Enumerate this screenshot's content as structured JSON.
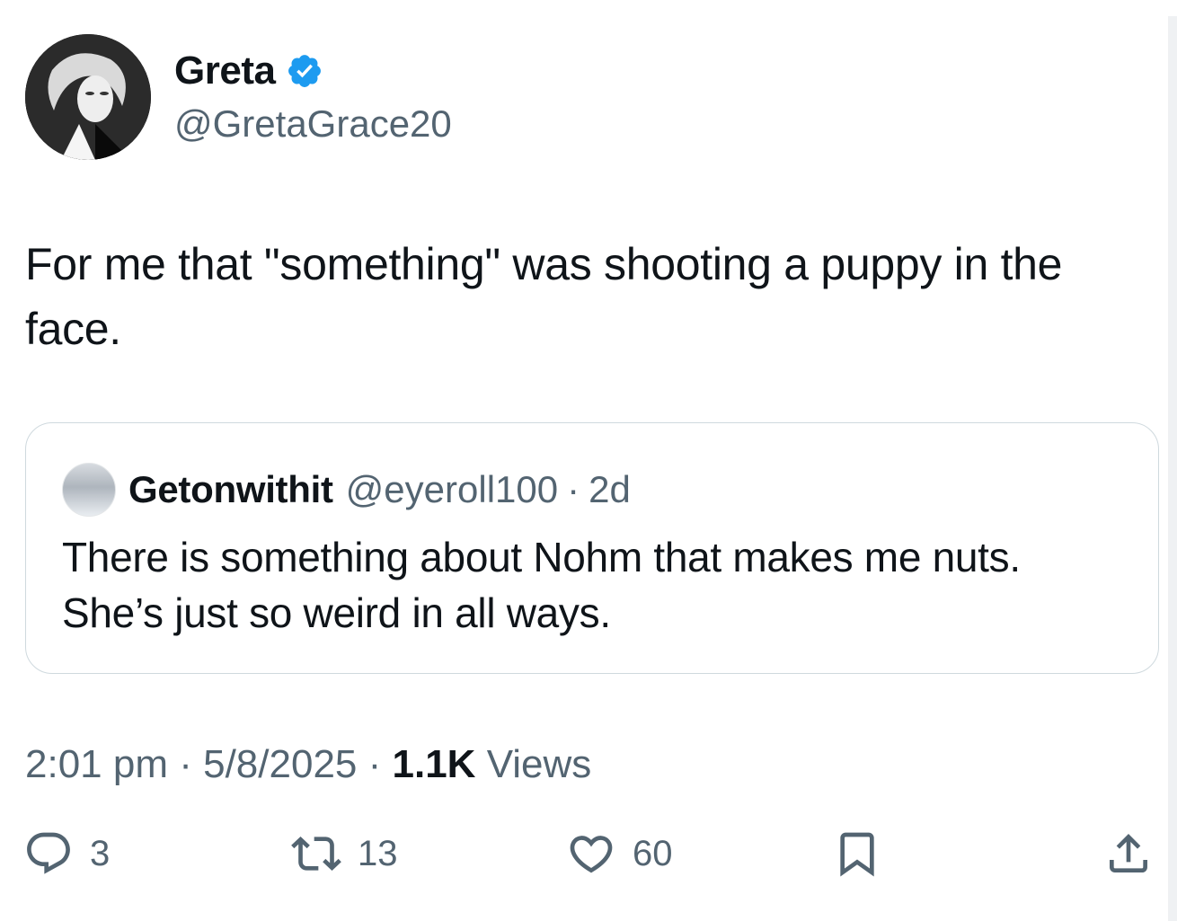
{
  "author": {
    "display_name": "Greta",
    "handle": "@GretaGrace20",
    "verified": true,
    "avatar_icon": "portrait-avatar"
  },
  "tweet": {
    "text": "For me that \"something\" was shooting a puppy in the face."
  },
  "quoted_tweet": {
    "display_name": "Getonwithit",
    "handle": "@eyeroll100",
    "separator": "·",
    "time": "2d",
    "text": "There is something about Nohm that makes me nuts. She’s just so weird in all ways."
  },
  "meta": {
    "time": "2:01 pm",
    "separator": "·",
    "date": "5/8/2025",
    "views_count": "1.1K",
    "views_label": "Views"
  },
  "actions": {
    "replies": "3",
    "reposts": "13",
    "likes": "60"
  },
  "colors": {
    "text": "#0f1419",
    "muted": "#536471",
    "border": "#cfd9de",
    "verified_blue": "#1d9bf0"
  }
}
